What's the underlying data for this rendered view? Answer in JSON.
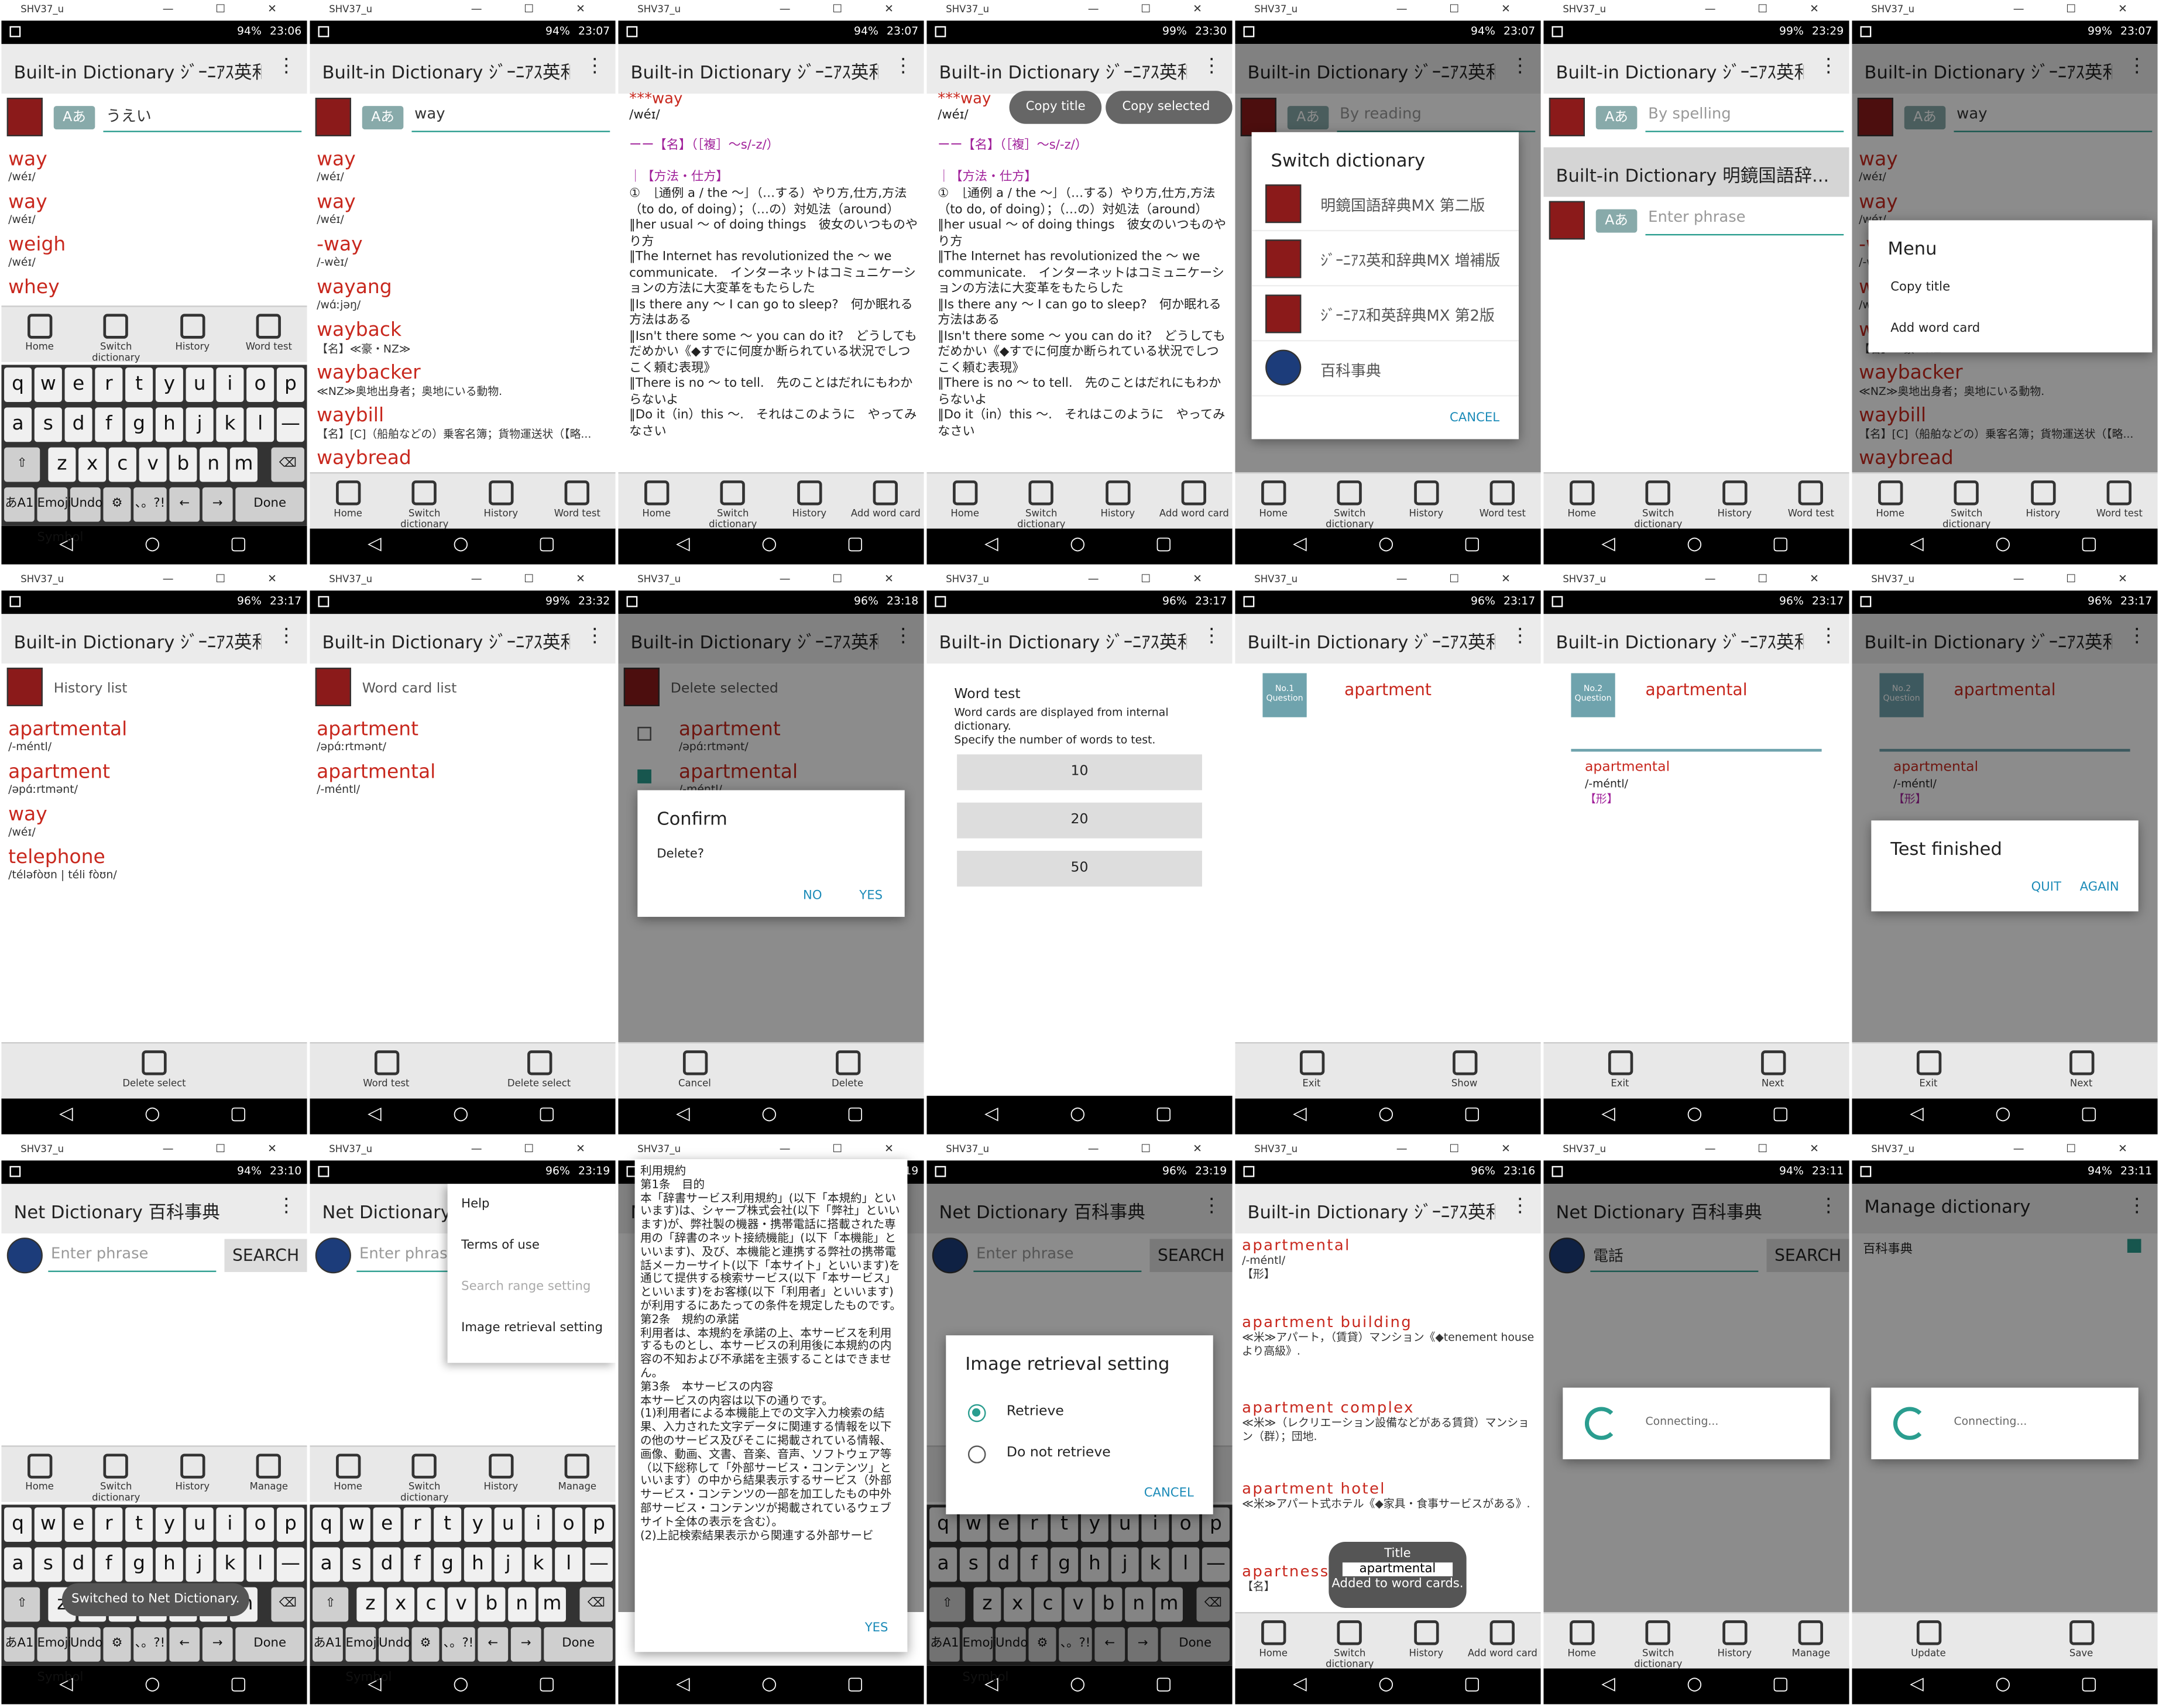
{
  "device": "SHV37_u",
  "win_controls": "—  ☐  ✕",
  "times": [
    "23:06",
    "23:07",
    "23:07",
    "23:30",
    "23:07",
    "23:29",
    "23:07",
    "23:17",
    "23:32",
    "23:18",
    "23:17",
    "23:17",
    "23:17",
    "23:17",
    "23:10",
    "23:19",
    "23:19",
    "23:19",
    "23:16",
    "23:11",
    "23:11"
  ],
  "battery": [
    "94%",
    "94%",
    "94%",
    "99%",
    "94%",
    "99%",
    "99%",
    "96%",
    "99%",
    "96%",
    "96%",
    "96%",
    "96%",
    "96%",
    "94%",
    "96%",
    "96%",
    "96%",
    "96%",
    "94%",
    "94%"
  ],
  "titles": {
    "builtin": "Built-in Dictionary ｼﾞｰﾆｱｽ英和...",
    "builtin_b": "Built-in Dictionary ｼﾞｰﾆｱｽ英和辞典...",
    "meikyo": "Built-in Dictionary 明鏡国語辞...",
    "net": "Net Dictionary 百科事典",
    "manage": "Manage dictionary"
  },
  "queries": {
    "q1": "うえい",
    "q2": "way",
    "q3": "way",
    "ph_reading": "By reading",
    "ph_spelling": "By spelling",
    "ph_phrase": "Enter phrase",
    "denwa": "電話"
  },
  "kana_btn": "Aあ",
  "search_btn": "SEARCH",
  "results1": [
    {
      "h": "way",
      "p": "/wéɪ/"
    },
    {
      "h": "way",
      "p": "/wéɪ/"
    },
    {
      "h": "weigh",
      "p": "/wéɪ/"
    },
    {
      "h": "whey",
      "p": ""
    }
  ],
  "results2": [
    {
      "h": "way",
      "p": "/wéɪ/"
    },
    {
      "h": "way",
      "p": "/wéɪ/"
    },
    {
      "h": "-way",
      "p": "/-wèɪ/"
    },
    {
      "h": "wayang",
      "p": "/wɑ́ːjəŋ/"
    },
    {
      "h": "wayback",
      "p": "【名】≪豪・NZ≫"
    },
    {
      "h": "waybacker",
      "p": "≪NZ≫奥地出身者；奥地にいる動物."
    },
    {
      "h": "waybill",
      "p": "【名】[C]（船舶などの）乗客名簿；貨物運送状（【略..."
    },
    {
      "h": "waybread",
      "p": ""
    }
  ],
  "tabs": {
    "home": "Home",
    "switch": "Switch dictionary",
    "history": "History",
    "wordtest": "Word test",
    "addcard": "Add word card",
    "manage": "Manage",
    "delsel": "Delete select",
    "cancel": "Cancel",
    "delete": "Delete",
    "exit": "Exit",
    "show": "Show",
    "next": "Next",
    "update": "Update",
    "save": "Save"
  },
  "keys": {
    "r1": [
      "q",
      "w",
      "e",
      "r",
      "t",
      "y",
      "u",
      "i",
      "o",
      "p"
    ],
    "r2": [
      "a",
      "s",
      "d",
      "f",
      "g",
      "h",
      "j",
      "k",
      "l",
      "—"
    ],
    "r3": [
      "z",
      "x",
      "c",
      "v",
      "b",
      "n",
      "m"
    ],
    "special": [
      "あA1",
      "Emoji Symbol",
      "Undo",
      "⚙",
      "、。?!",
      "←",
      "→",
      "Done"
    ]
  },
  "entry_doc": {
    "head": "***way",
    "pron": "/wéɪ/",
    "l1": "ーー【名】（［複］～s/-z/）",
    "l2": "｜【方法・仕方】",
    "body": "①　［通例 a / the ～］（…する）やり方,仕方,方法（to do, of doing）；（…の）対処法（around）\n‖her usual ～ of doing things　彼女のいつものやり方\n‖The Internet has revolutionized the ～ we communicate.　インターネットはコミュニケーションの方法に大変革をもたらした\n‖Is there any ～ I can go to sleep?　何か眠れる方法はある\n‖Isn't there some ～ you can do it?　どうしてもだめかい《◆すでに何度か断られている状況でしつこく頼む表現》\n‖There is no ～ to tell.　先のことはだれにもわからないよ\n‖Do it（in）this ～.　それはこのように　やってみなさい"
  },
  "copy_title": "Copy title",
  "copy_selected": "Copy selected text",
  "switch_dlg": {
    "title": "Switch dictionary",
    "items": [
      "明鏡国語辞典MX 第二版",
      "ｼﾞｰﾆｱｽ英和辞典MX 増補版",
      "ｼﾞｰﾆｱｽ和英辞典MX 第2版",
      "百科事典"
    ],
    "cancel": "CANCEL"
  },
  "menu_dlg": {
    "title": "Menu",
    "items": [
      "Copy title",
      "Add word card"
    ]
  },
  "history_label": "History list",
  "history": [
    {
      "h": "apartmental",
      "p": "/-méntl/"
    },
    {
      "h": "apartment",
      "p": "/əpɑ́ːrtmənt/"
    },
    {
      "h": "way",
      "p": "/wéɪ/"
    },
    {
      "h": "telephone",
      "p": "/téləfòʊn | téli fòʊn/"
    }
  ],
  "card_label": "Word card list",
  "cards": [
    {
      "h": "apartment",
      "p": "/əpɑ́ːrtmənt/"
    },
    {
      "h": "apartmental",
      "p": "/-méntl/"
    }
  ],
  "delete_label": "Delete selected",
  "confirm": {
    "title": "Confirm",
    "msg": "Delete?",
    "no": "NO",
    "yes": "YES"
  },
  "wordtest": {
    "title": "Word test",
    "desc": "Word cards are displayed from internal dictionary.\nSpecify the number of words to test.",
    "options": [
      "10",
      "20",
      "50"
    ]
  },
  "quiz": [
    {
      "badge": "No.1 Question",
      "word": "apartment"
    },
    {
      "badge": "No.2 Question",
      "word": "apartmental"
    }
  ],
  "ans": {
    "h": "apartmental",
    "p": "/-méntl/",
    "pos": "【形】"
  },
  "finished": {
    "title": "Test finished",
    "quit": "QUIT",
    "again": "AGAIN"
  },
  "net_menu": [
    "Help",
    "Terms of use",
    "Search range setting",
    "Image retrieval setting"
  ],
  "toast_net": "Switched to Net Dictionary.",
  "terms": "利用規約\n第1条　目的\n本「辞書サービス利用規約」(以下「本規約」といいます)は、シャープ株式会社(以下「弊社」といいます)が、弊社製の機器・携帯電話に搭載された専用の「辞書のネット接続機能」(以下「本機能」といいます)、及び、本機能と連携する弊社の携帯電話メーカーサイト(以下「本サイト」といいます)を通じて提供する検索サービス(以下「本サービス」といいます)をお客様(以下「利用者」といいます)が利用するにあたっての条件を規定したものです。\n第2条　規約の承諾\n利用者は、本規約を承諾の上、本サービスを利用するものとし、本サービスの利用後に本規約の内容の不知および不承諾を主張することはできません。\n第3条　本サービスの内容\n本サービスの内容は以下の通りです。\n(1)利用者による本機能上での文字入力検索の結果、入力された文字データに関連する情報を以下の他のサービス及びそこに掲載されている情報、画像、動画、文書、音楽、音声、ソフトウェア等（以下総称して「外部サービス・コンテンツ」といいます）の中から結果表示するサービス（外部サービス・コンテンツの一部を加工したもの中外部サービス・コンテンツが掲載されているウェブサイト全体の表示を含む）。\n(2)上記検索結果表示から関連する外部サービ",
  "terms_yes": "YES",
  "img_dlg": {
    "title": "Image retrieval setting",
    "opts": [
      "Retrieve",
      "Do not retrieve"
    ],
    "cancel": "CANCEL"
  },
  "apt_list": [
    {
      "h": "apartmental",
      "p": "/-méntl/\n【形】"
    },
    {
      "h": "apartment building",
      "p": "≪米≫アパート，（賃貸）マンション《◆tenement house より高級》."
    },
    {
      "h": "apartment complex",
      "p": "≪米≫（レクリエーション設備などがある賃貸）マンション（群）；団地."
    },
    {
      "h": "apartment hotel",
      "p": "≪米≫アパート式ホテル《◆家具・食事サービスがある》."
    },
    {
      "h": "apartness",
      "p": "【名】"
    }
  ],
  "added": {
    "t": "Title",
    "w": "apartmental",
    "m": "Added to word cards."
  },
  "connecting": "Connecting...",
  "manage_item": "百科事典"
}
